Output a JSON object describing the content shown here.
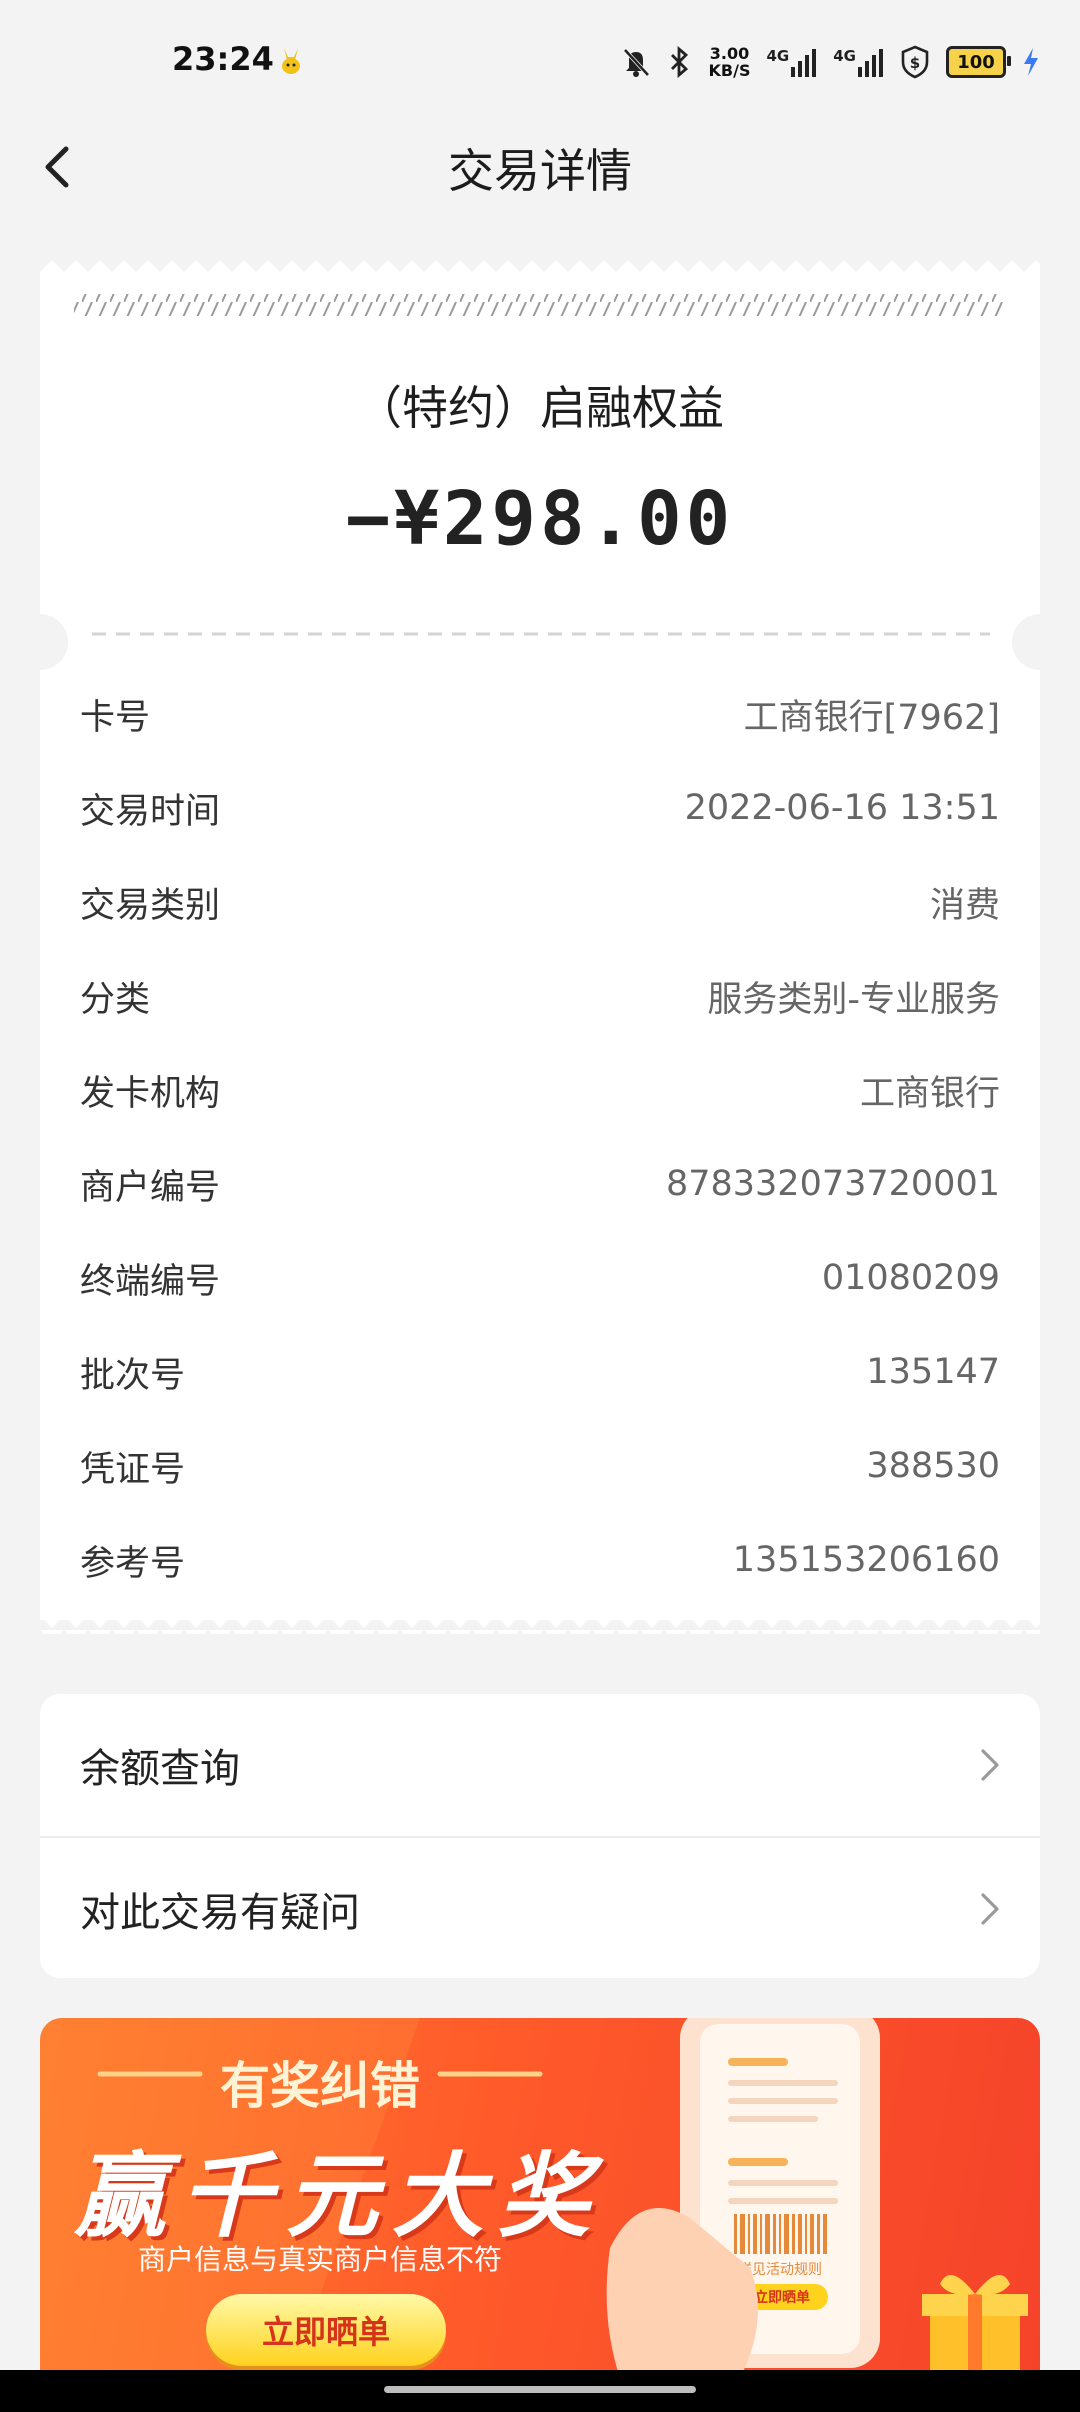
{
  "status_bar": {
    "time": "23:24",
    "speed_value": "3.00",
    "speed_unit": "KB/S",
    "network_1": "4G",
    "network_2": "4G",
    "battery": "100",
    "icons": [
      "mute-icon",
      "bluetooth-icon",
      "signal-icon",
      "signal-icon",
      "shield-icon",
      "battery-icon",
      "charging-icon"
    ]
  },
  "header": {
    "title": "交易详情"
  },
  "receipt": {
    "merchant": "（特约）启融权益",
    "amount": "−¥298.00",
    "details": [
      {
        "label": "卡号",
        "value": "工商银行[7962]"
      },
      {
        "label": "交易时间",
        "value": "2022-06-16 13:51"
      },
      {
        "label": "交易类别",
        "value": "消费"
      },
      {
        "label": "分类",
        "value": "服务类别-专业服务"
      },
      {
        "label": "发卡机构",
        "value": "工商银行"
      },
      {
        "label": "商户编号",
        "value": "878332073720001"
      },
      {
        "label": "终端编号",
        "value": "01080209"
      },
      {
        "label": "批次号",
        "value": "135147"
      },
      {
        "label": "凭证号",
        "value": "388530"
      },
      {
        "label": "参考号",
        "value": "135153206160"
      }
    ]
  },
  "actions": [
    {
      "label": "余额查询"
    },
    {
      "label": "对此交易有疑问"
    }
  ],
  "banner": {
    "subtitle": "有奖纠错",
    "headline": "赢千元大奖",
    "description": "商户信息与真实商户信息不符",
    "button": "立即晒单",
    "art_caption": "详见活动规则",
    "art_button": "立即晒单"
  },
  "colors": {
    "background": "#f3f3f3",
    "card": "#ffffff",
    "banner_start": "#ff7c2e",
    "banner_end": "#f5432a",
    "button_yellow": "#ffd21d",
    "button_text": "#d6341a"
  }
}
